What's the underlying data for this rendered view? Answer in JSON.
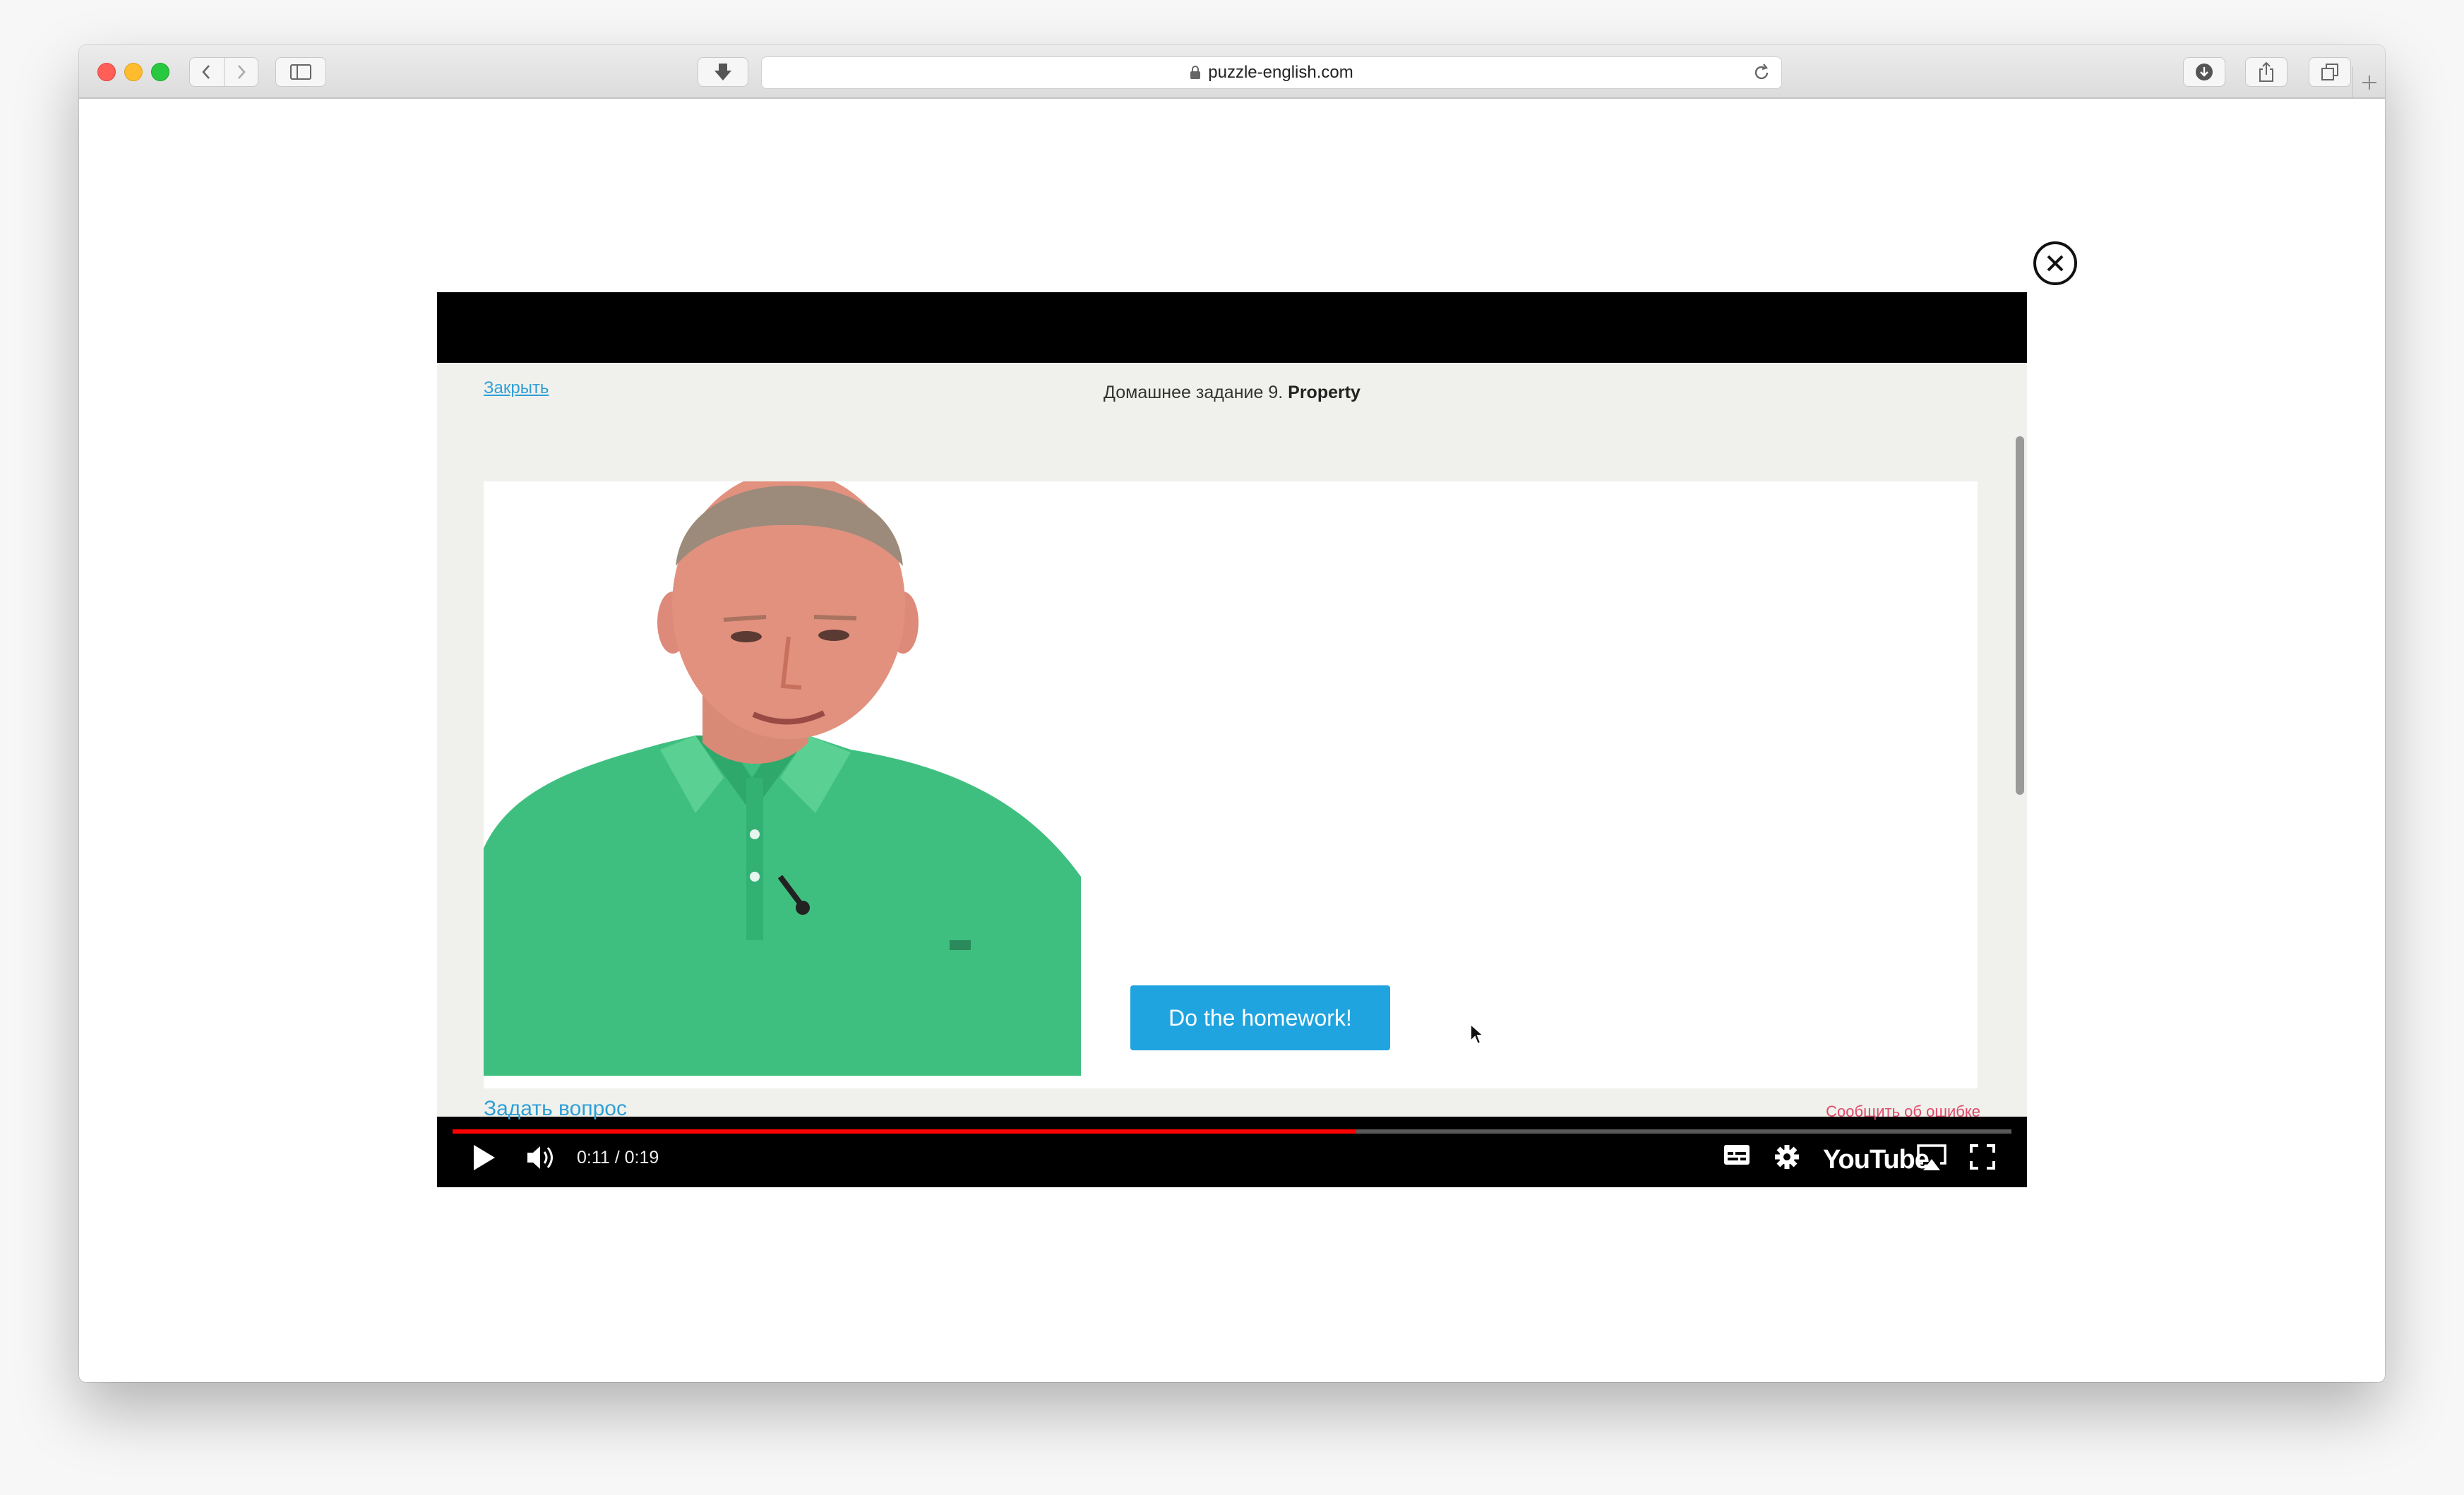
{
  "browser": {
    "url": "puzzle-english.com"
  },
  "video_page": {
    "close_link": "Закрыть",
    "title_prefix": "Домашнее задание 9.",
    "title_bold": "Property",
    "cta_button": "Do the homework!",
    "ask_link": "Задать вопрос",
    "report_link": "Сообщить об ошибке"
  },
  "player": {
    "time": "0:11 / 0:19",
    "progress": 0.5796,
    "brand": "YouTube"
  },
  "icons": {
    "close": "close-circle-icon",
    "play": "play-icon",
    "volume": "volume-icon",
    "subtitles": "subtitles-icon",
    "settings": "gear-icon",
    "airplay": "airplay-icon",
    "fullscreen": "fullscreen-icon"
  },
  "colors": {
    "accent_blue": "#1fa4e0",
    "progress_red": "#ff0000",
    "shirt_green": "#3fbf7f"
  }
}
